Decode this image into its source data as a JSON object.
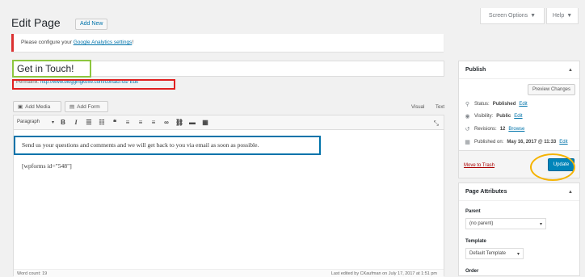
{
  "screen_options": {
    "label": "Screen Options",
    "arrow": "▼"
  },
  "help": {
    "label": "Help",
    "arrow": "▼"
  },
  "heading": {
    "title": "Edit Page",
    "add_new": "Add New"
  },
  "notice": {
    "prefix": "Please configure your ",
    "link": "Google Analytics settings",
    "suffix": "!"
  },
  "post": {
    "title": "Get in Touch!",
    "permalink_label": "Permalink:",
    "permalink_url": "http://www.bloggingkoffe.com/contact-us/",
    "permalink_edit": "Edit"
  },
  "editor": {
    "add_media": "Add Media",
    "add_form": "Add Form",
    "tab_visual": "Visual",
    "tab_text": "Text",
    "format_select": "Paragraph",
    "content": "Send us your questions and comments and we will get back to you via email as soon as possible.",
    "shortcode": "[wpforms id=\"548\"]",
    "word_count": "Word count: 19",
    "last_edited": "Last edited by CKaufman on July 17, 2017 at 1:51 pm"
  },
  "publish": {
    "title": "Publish",
    "preview": "Preview Changes",
    "status_label": "Status:",
    "status_value": "Published",
    "visibility_label": "Visibility:",
    "visibility_value": "Public",
    "revisions_label": "Revisions:",
    "revisions_value": "12",
    "browse": "Browse",
    "published_label": "Published on:",
    "published_value": "May 16, 2017 @ 11:33",
    "edit": "Edit",
    "trash": "Move to Trash",
    "update": "Update"
  },
  "attributes": {
    "title": "Page Attributes",
    "parent_label": "Parent",
    "parent_value": "(no parent)",
    "template_label": "Template",
    "template_value": "Default Template",
    "order_label": "Order"
  },
  "colors": {
    "link": "#0073aa",
    "primary_button": "#0085ba",
    "notice_error": "#dc3232",
    "highlight_green": "#8dc63f",
    "highlight_red": "#e02020",
    "highlight_blue": "#0073aa",
    "highlight_yellow": "#f5b300"
  },
  "icons": {
    "toolbar": [
      "bold-icon",
      "italic-icon",
      "bullet-list-icon",
      "numbered-list-icon",
      "blockquote-icon",
      "align-left-icon",
      "align-center-icon",
      "align-right-icon",
      "link-icon",
      "unlink-icon",
      "read-more-icon",
      "toolbar-toggle-icon"
    ]
  }
}
